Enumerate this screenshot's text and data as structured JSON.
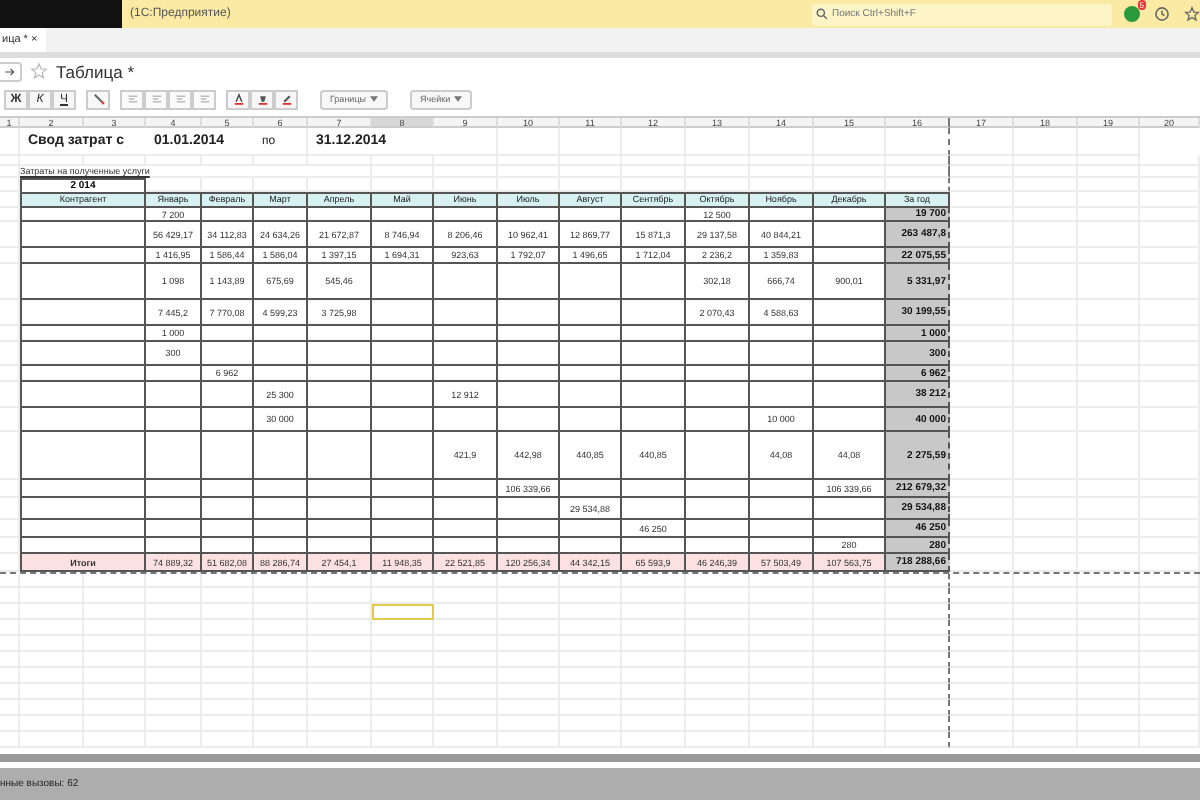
{
  "app": {
    "title": "(1С:Предприятие)",
    "search": {
      "placeholder": "Поиск Ctrl+Shift+F"
    },
    "badge": "5"
  },
  "tabs": [
    {
      "label": "ица *",
      "close": "×",
      "selected": true
    }
  ],
  "page": {
    "title": "Таблица *"
  },
  "toolbar": {
    "format_buttons": [
      {
        "label": "Ж",
        "kind": "bold"
      },
      {
        "label": "К",
        "kind": "italic"
      },
      {
        "label": "Ч",
        "kind": "underline"
      }
    ],
    "dropdowns": [
      "Границы",
      "Ячейки"
    ]
  },
  "column_headers": [
    "1",
    "2",
    "3",
    "4",
    "5",
    "6",
    "7",
    "8",
    "9",
    "10",
    "11",
    "12",
    "13",
    "14",
    "15",
    "16",
    "17",
    "18",
    "19",
    "20"
  ],
  "report": {
    "title": "Свод затрат с",
    "date_from": "01.01.2014",
    "date_sep": "по",
    "date_to": "31.12.2014",
    "subtitle": "Затраты на полученные услуги",
    "year": "2 014",
    "headers": [
      "Контрагент",
      "Январь",
      "Февраль",
      "Март",
      "Апрель",
      "Май",
      "Июнь",
      "Июль",
      "Август",
      "Сентябрь",
      "Октябрь",
      "Ноябрь",
      "Декабрь",
      "За год"
    ],
    "rows": [
      {
        "cells": [
          "7 200",
          null,
          null,
          null,
          null,
          null,
          null,
          null,
          null,
          "12 500",
          null,
          null
        ],
        "total": "19 700"
      },
      {
        "cells": [
          "56 429,17",
          "34 112,83",
          "24 634,26",
          "21 672,87",
          "8 746,94",
          "8 206,46",
          "10 962,41",
          "12 869,77",
          "15 871,3",
          "29 137,58",
          "40 844,21",
          null
        ],
        "total": "263 487,8"
      },
      {
        "cells": [
          "1 416,95",
          "1 586,44",
          "1 586,04",
          "1 397,15",
          "1 694,31",
          "923,63",
          "1 792,07",
          "1 496,65",
          "1 712,04",
          "2 236,2",
          "1 359,83",
          null
        ],
        "total": "22 075,55"
      },
      {
        "cells": [
          "1 098",
          "1 143,89",
          "675,69",
          "545,46",
          null,
          null,
          null,
          null,
          null,
          "302,18",
          "666,74",
          "900,01"
        ],
        "total": "5 331,97"
      },
      {
        "cells": [
          "7 445,2",
          "7 770,08",
          "4 599,23",
          "3 725,98",
          null,
          null,
          null,
          null,
          null,
          "2 070,43",
          "4 588,63",
          null
        ],
        "total": "30 199,55"
      },
      {
        "cells": [
          "1 000",
          null,
          null,
          null,
          null,
          null,
          null,
          null,
          null,
          null,
          null,
          null
        ],
        "total": "1 000"
      },
      {
        "cells": [
          "300",
          null,
          null,
          null,
          null,
          null,
          null,
          null,
          null,
          null,
          null,
          null
        ],
        "total": "300"
      },
      {
        "cells": [
          null,
          "6 962",
          null,
          null,
          null,
          null,
          null,
          null,
          null,
          null,
          null,
          null
        ],
        "total": "6 962"
      },
      {
        "cells": [
          null,
          null,
          "25 300",
          null,
          null,
          "12 912",
          null,
          null,
          null,
          null,
          null,
          null
        ],
        "total": "38 212"
      },
      {
        "cells": [
          null,
          null,
          "30 000",
          null,
          null,
          null,
          null,
          null,
          null,
          null,
          "10 000",
          null
        ],
        "total": "40 000"
      },
      {
        "cells": [
          null,
          null,
          null,
          null,
          null,
          "421,9",
          "442,98",
          "440,85",
          "440,85",
          null,
          "44,08",
          "44,08"
        ],
        "total": "2 275,59"
      },
      {
        "cells": [
          null,
          null,
          null,
          null,
          null,
          null,
          "106 339,66",
          null,
          null,
          null,
          null,
          "106 339,66"
        ],
        "total": "212 679,32"
      },
      {
        "cells": [
          null,
          null,
          null,
          null,
          null,
          null,
          null,
          "29 534,88",
          null,
          null,
          null,
          null
        ],
        "total": "29 534,88"
      },
      {
        "cells": [
          null,
          null,
          null,
          null,
          null,
          null,
          null,
          null,
          "46 250",
          null,
          null,
          null
        ],
        "total": "46 250"
      },
      {
        "cells": [
          null,
          null,
          null,
          null,
          null,
          null,
          null,
          null,
          null,
          null,
          null,
          "280"
        ],
        "total": "280"
      }
    ],
    "totals": {
      "label": "Итоги",
      "cells": [
        "74 889,32",
        "51 682,08",
        "88 286,74",
        "27 454,1",
        "11 948,35",
        "22 521,85",
        "120 256,34",
        "44 342,15",
        "65 593,9",
        "46 246,39",
        "57 503,49",
        "107 563,75"
      ],
      "total": "718 288,66"
    }
  },
  "status_bar": "нные вызовы: 62"
}
